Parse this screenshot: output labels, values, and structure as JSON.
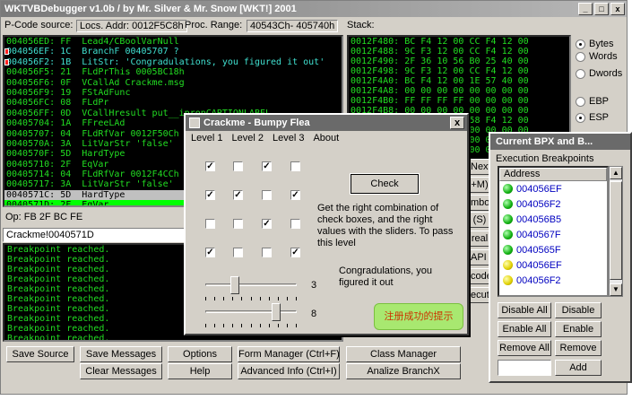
{
  "window": {
    "title": "WKTVBDebugger v1.0b / by Mr. Silver & Mr. Snow [WKT!] 2001",
    "minimize": "_",
    "maximize": "□",
    "close": "x"
  },
  "infobar": {
    "pcode_source": "P-Code source:",
    "locs_addr": "Locs. Addr: 0012F5C8h",
    "proc_range_label": "Proc. Range:",
    "proc_range_value": "40543Ch- 405740h",
    "stack_label": "Stack:"
  },
  "code_lines": [
    {
      "text": "004056ED: FF  Lead4/CBoolVarNull",
      "style": "",
      "bp": false
    },
    {
      "text": "004056EF: 1C  BranchF 00405707 ?",
      "style": "cyan",
      "bp": true
    },
    {
      "text": "004056F2: 1B  LitStr: 'Congradulations, you figured it out'",
      "style": "cyan",
      "bp": true
    },
    {
      "text": "004056F5: 21  FLdPrThis 0005BC18h",
      "style": "",
      "bp": false
    },
    {
      "text": "004056F6: 0F  VCallAd Crackme.msg",
      "style": "",
      "bp": false
    },
    {
      "text": "004056F9: 19  FStAdFunc",
      "style": "",
      "bp": false
    },
    {
      "text": "004056FC: 08  FLdPr",
      "style": "",
      "bp": false
    },
    {
      "text": "004056FF: 0D  VCallHresult put__ipropCAPTIONLABEL",
      "style": "",
      "bp": false
    },
    {
      "text": "00405704: 1A  FFreeLAd",
      "style": "",
      "bp": false
    },
    {
      "text": "00405707: 04  FLdRfVar 0012F50Ch",
      "style": "",
      "bp": false
    },
    {
      "text": "0040570A: 3A  LitVarStr 'false'",
      "style": "",
      "bp": false
    },
    {
      "text": "0040570F: 5D  HardType",
      "style": "",
      "bp": false
    },
    {
      "text": "00405710: 2F  EqVar",
      "style": "",
      "bp": false
    },
    {
      "text": "00405714: 04  FLdRfVar 0012F4CCh",
      "style": "",
      "bp": false
    },
    {
      "text": "00405717: 3A  LitVarStr 'false'",
      "style": "",
      "bp": false
    },
    {
      "text": "0040571C: 5D  HardType",
      "style": "sel-gray",
      "bp": false
    },
    {
      "text": "0040571D: 2F  EqVar",
      "style": "sel-green",
      "bp": false
    },
    {
      "text": "00405721: 27  AndVar",
      "style": "",
      "bp": false
    },
    {
      "text": "00405725: FF  Lead4/CBoolVarNull",
      "style": "",
      "bp": false
    }
  ],
  "op_line": "Op: FB 2F BC FE",
  "addr_line": "Crackme!0040571D",
  "log_lines": [
    "Breakpoint reached.",
    "Breakpoint reached.",
    "Breakpoint reached.",
    "Breakpoint reached.",
    "Breakpoint reached.",
    "Breakpoint reached.",
    "Breakpoint reached.",
    "Breakpoint reached.",
    "Breakpoint reached.",
    "Breakpoint reached."
  ],
  "stack_lines": [
    "0012F480: BC F4 12 00 CC F4 12 00",
    "0012F488: 9C F3 12 00 CC F4 12 00",
    "0012F490: 2F 36 10 56 B0 25 40 00",
    "0012F498: 9C F3 12 00 CC F4 12 00",
    "0012F4A0: BC F4 12 00 1E 57 40 00",
    "0012F4A8: 00 00 00 00 00 00 00 00",
    "0012F4B0: FF FF FF FF 00 00 00 00",
    "0012F4B8: 00 00 00 00 00 00 00 00",
    "0012F4C0: F8 F5 12 00 58 F4 12 00",
    "0012F4C8: 00 00 00 00 00 00 00 00",
    "0012F4D0: 00 00 00 00 00 00 00 00",
    "0012F4D8: 00 00 00 00 00 00 00 00"
  ],
  "esp_label": "ESP",
  "radios_top": [
    "Bytes",
    "Words",
    "Dwords"
  ],
  "radios_bottom": [
    "EBP",
    "ESP"
  ],
  "side_buttons": [
    "Next",
    "+M)",
    "mbol",
    "(S)",
    "real",
    "API (",
    "code",
    "ecut"
  ],
  "bottom_buttons": {
    "save_source": "Save Source",
    "save_messages": "Save Messages",
    "options": "Options",
    "form_manager": "Form Manager (Ctrl+F)",
    "class_manager": "Class Manager",
    "clear_messages": "Clear Messages",
    "help": "Help",
    "advanced_info": "Advanced Info (Ctrl+I)",
    "analize_branch": "Analize BranchX"
  },
  "crackme": {
    "title": "Crackme - Bumpy Flea",
    "close": "x",
    "menu": [
      "Level 1",
      "Level 2",
      "Level 3",
      "About"
    ],
    "checkboxes": [
      [
        true,
        false,
        true,
        false
      ],
      [
        true,
        true,
        false,
        true
      ],
      [
        false,
        false,
        true,
        false
      ],
      [
        true,
        false,
        false,
        true
      ]
    ],
    "check_button": "Check",
    "instructions": [
      "Get the right combination of",
      "check boxes, and the right",
      "values with the sliders. To pass",
      "this level"
    ],
    "result": [
      "Congradulations, you",
      "figured it out"
    ],
    "slider1_value": "3",
    "slider1_fraction": 0.3,
    "slider2_value": "8",
    "slider2_fraction": 0.8,
    "annotation": "注册成功的提示"
  },
  "breakpoints": {
    "title": "Current BPX and B...",
    "group_label": "Execution Breakpoints",
    "column": "Address",
    "items": [
      {
        "addr": "004056EF",
        "color": "green"
      },
      {
        "addr": "004056F2",
        "color": "green"
      },
      {
        "addr": "004056B5",
        "color": "green"
      },
      {
        "addr": "0040567F",
        "color": "green"
      },
      {
        "addr": "0040565F",
        "color": "green"
      },
      {
        "addr": "004056EF",
        "color": "yellow"
      },
      {
        "addr": "004056F2",
        "color": "yellow"
      }
    ],
    "buttons": [
      "Disable All",
      "Disable",
      "Enable All",
      "Enable",
      "Remove All",
      "Remove",
      "Add"
    ]
  }
}
